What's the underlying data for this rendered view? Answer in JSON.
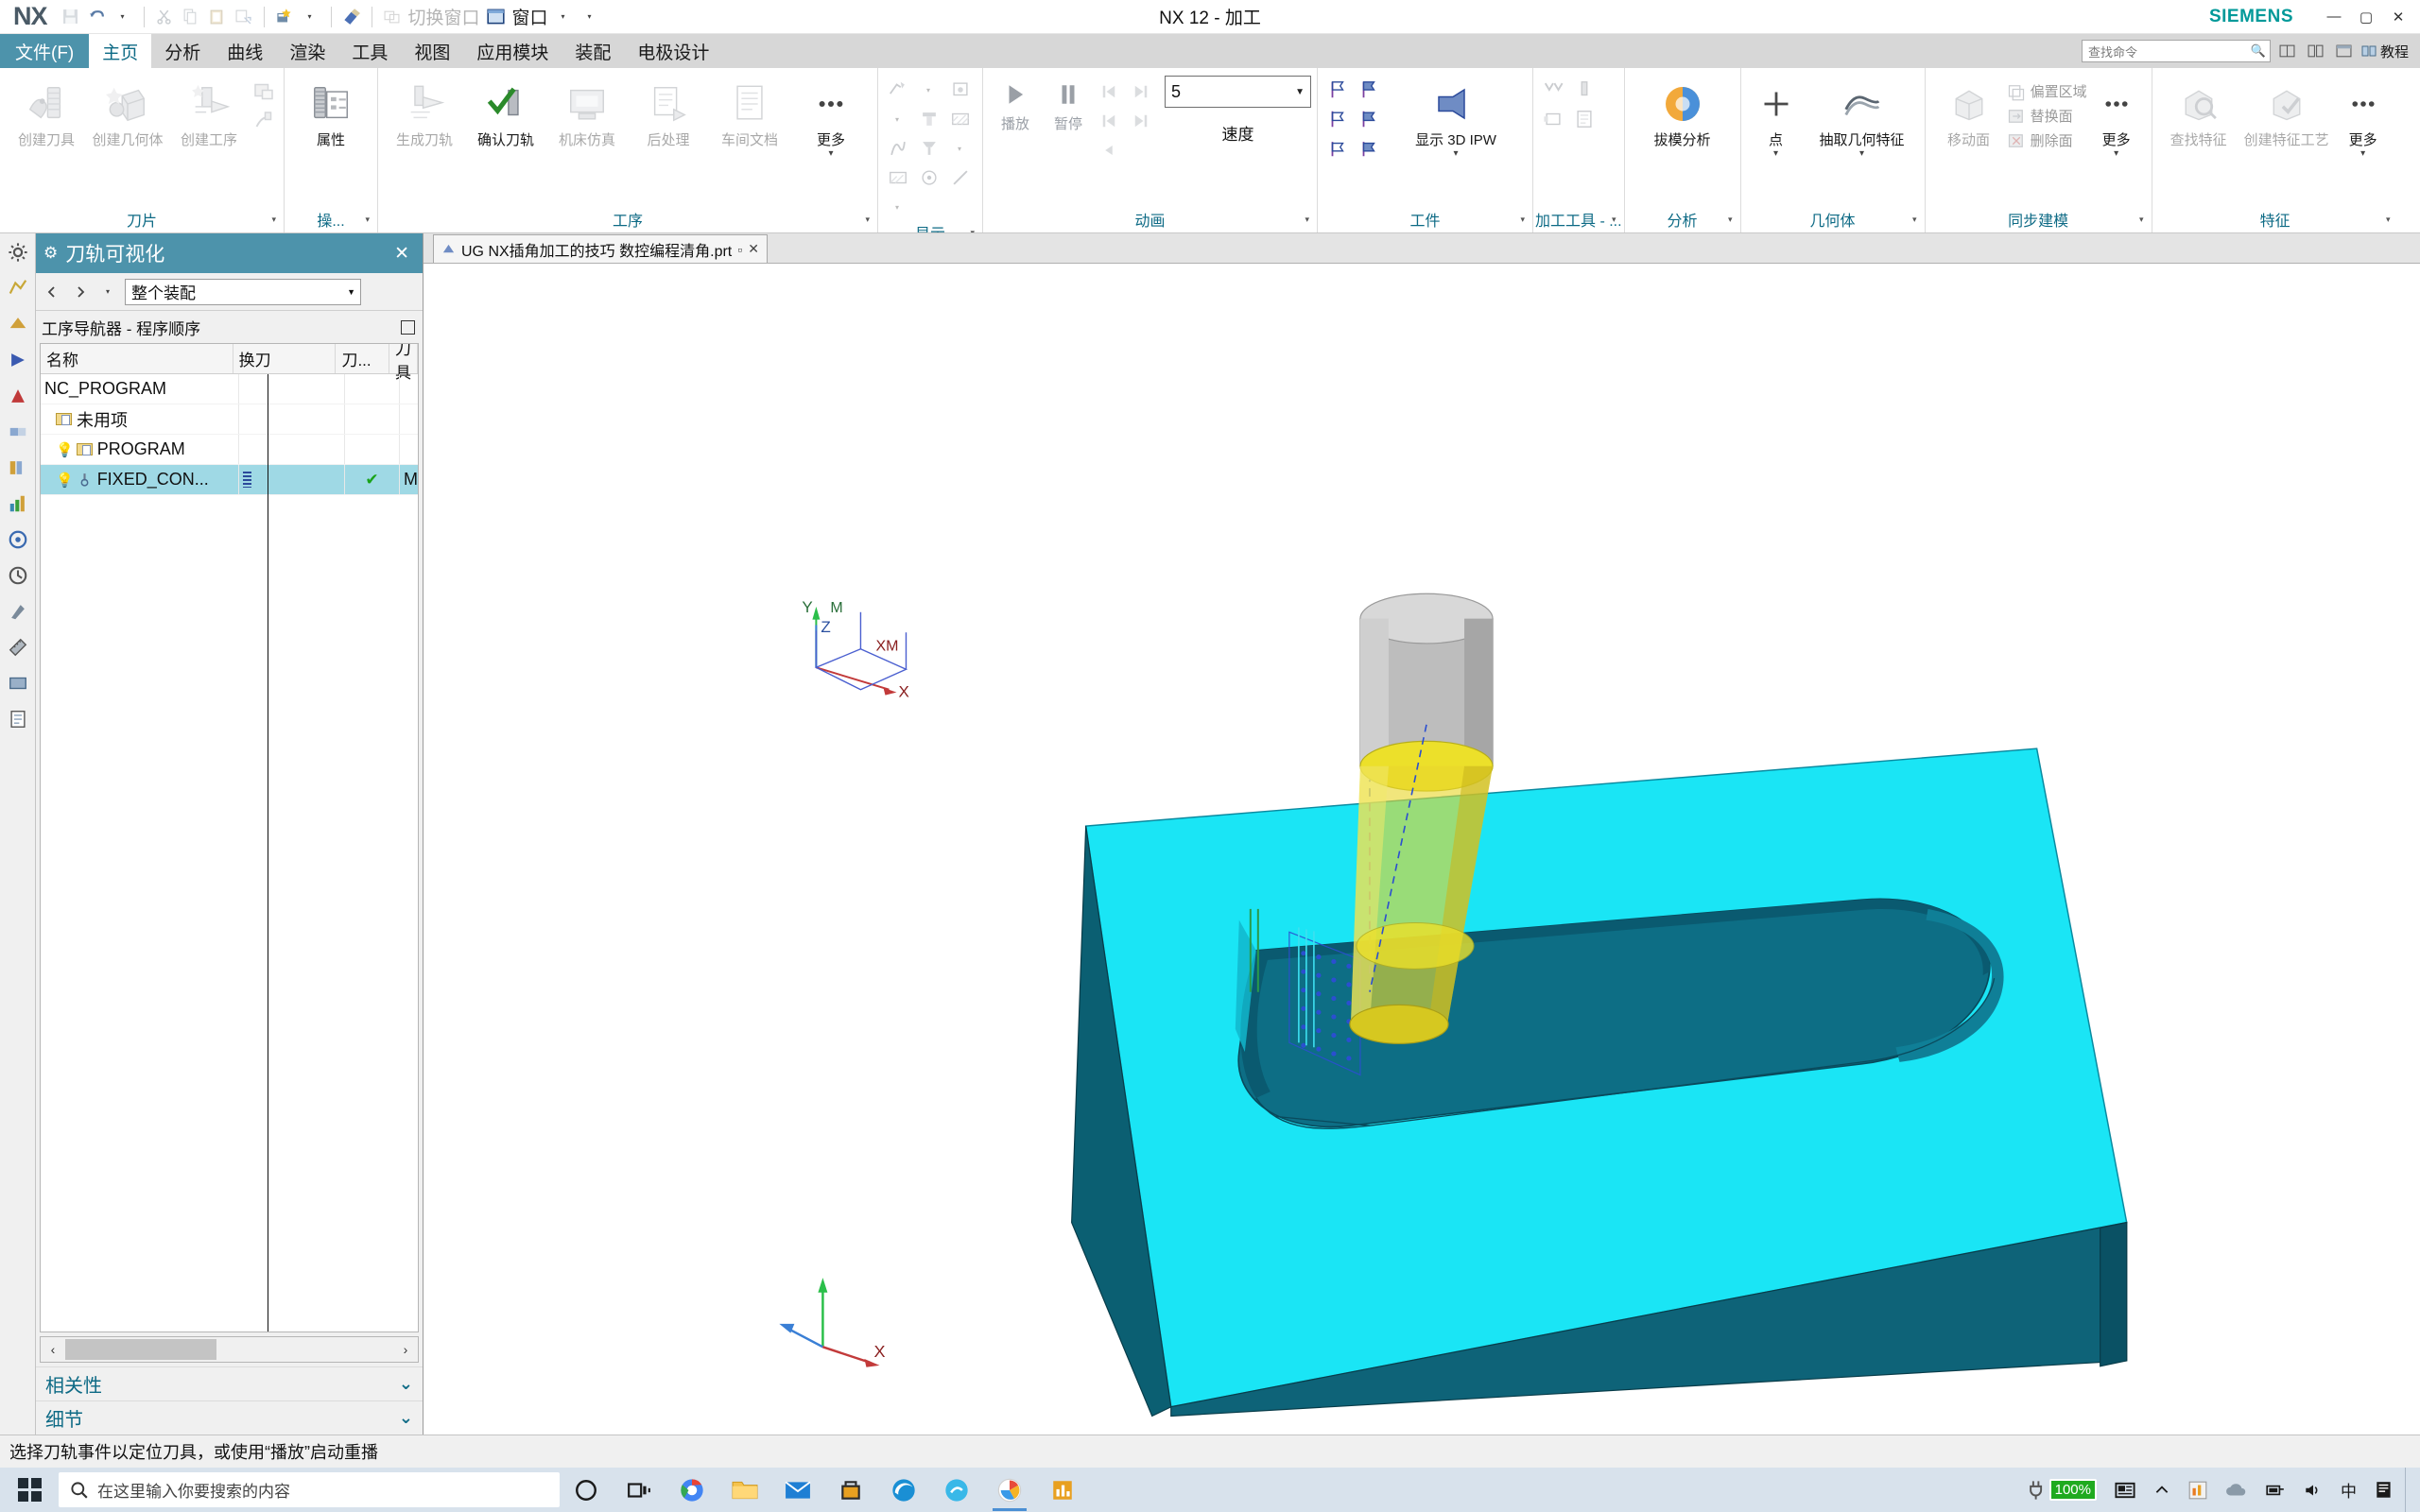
{
  "titlebar": {
    "logo": "NX",
    "title": "NX 12 - 加工",
    "brand": "SIEMENS",
    "quick_access": [
      {
        "name": "save-icon",
        "label": "保存",
        "dim": true
      },
      {
        "name": "undo-icon",
        "label": "撤销",
        "dim": false
      },
      {
        "name": "cut-icon",
        "label": "剪切",
        "dim": true
      },
      {
        "name": "copy-icon",
        "label": "复制",
        "dim": true
      },
      {
        "name": "paste-icon",
        "label": "粘贴",
        "dim": true
      },
      {
        "name": "paste-special-icon",
        "label": "选择性粘贴",
        "dim": true
      },
      {
        "name": "command-finder-icon",
        "label": "命令查找器",
        "dim": false
      },
      {
        "name": "eraser-icon",
        "label": "橡皮",
        "dim": false
      }
    ],
    "switch_window": "切换窗口",
    "window": "窗口",
    "win_buttons": {
      "minimize": "—",
      "maximize": "▢",
      "close": "✕"
    }
  },
  "menu": {
    "file_tab": "文件(F)",
    "tabs": [
      {
        "label": "主页",
        "active": true
      },
      {
        "label": "分析",
        "active": false
      },
      {
        "label": "曲线",
        "active": false
      },
      {
        "label": "渲染",
        "active": false
      },
      {
        "label": "工具",
        "active": false
      },
      {
        "label": "视图",
        "active": false
      },
      {
        "label": "应用模块",
        "active": false
      },
      {
        "label": "装配",
        "active": false
      },
      {
        "label": "电极设计",
        "active": false
      }
    ],
    "search_placeholder": "查找命令",
    "tutorial": "教程"
  },
  "ribbon": {
    "groups": [
      {
        "label": "刀片",
        "big_buttons": [
          {
            "label": "创建刀具",
            "icon": "create-tool-icon",
            "dim": true
          },
          {
            "label": "创建几何体",
            "icon": "create-geometry-icon",
            "dim": true
          },
          {
            "label": "创建工序",
            "icon": "create-operation-icon",
            "dim": true
          }
        ],
        "small_buttons": [
          {
            "name": "create-program-icon",
            "dim": true
          },
          {
            "name": "create-method-icon",
            "dim": true
          }
        ]
      },
      {
        "label": "操...",
        "big_buttons": [
          {
            "label": "属性",
            "icon": "properties-icon",
            "dim": false
          }
        ],
        "small_buttons": []
      },
      {
        "label": "工序",
        "big_buttons": [
          {
            "label": "生成刀轨",
            "icon": "generate-toolpath-icon",
            "dim": true
          },
          {
            "label": "确认刀轨",
            "icon": "verify-toolpath-icon",
            "dim": false
          },
          {
            "label": "机床仿真",
            "icon": "machine-sim-icon",
            "dim": true
          },
          {
            "label": "后处理",
            "icon": "postprocess-icon",
            "dim": true
          },
          {
            "label": "车间文档",
            "icon": "shop-doc-icon",
            "dim": true
          },
          {
            "label": "更多",
            "icon": "more-icon",
            "dim": false
          }
        ],
        "small_buttons": []
      },
      {
        "label": "显示",
        "big_buttons": [],
        "small_buttons": [
          {
            "name": "display-toolpath-icon",
            "dim": true
          },
          {
            "name": "display-tool-icon",
            "dim": true
          },
          {
            "name": "display-holder-icon",
            "dim": true
          },
          {
            "name": "hatch-area-icon",
            "dim": true
          },
          {
            "name": "curve-icon",
            "dim": true
          },
          {
            "name": "tool-shape-icon",
            "dim": true
          },
          {
            "name": "hatch-area2-icon",
            "dim": true
          },
          {
            "name": "point-target-icon",
            "dim": true
          },
          {
            "name": "line-icon",
            "dim": true
          }
        ]
      },
      {
        "label": "动画",
        "play": "播放",
        "pause": "暂停",
        "step_back": "上一步",
        "step_fwd": "下一步",
        "speed_value": "5",
        "speed_label": "速度",
        "big_buttons": [],
        "small_buttons": []
      },
      {
        "label": "工件",
        "big_buttons": [
          {
            "label": "显示 3D IPW",
            "icon": "show-3d-ipw-icon",
            "dim": false
          }
        ],
        "small_buttons": [
          {
            "name": "ipw-flag1-icon",
            "dim": false
          },
          {
            "name": "ipw-flag2-icon",
            "dim": false
          },
          {
            "name": "ipw-flag3-icon",
            "dim": false
          },
          {
            "name": "ipw-flag4-icon",
            "dim": false
          },
          {
            "name": "ipw-flag5-icon",
            "dim": false
          },
          {
            "name": "ipw-flag6-icon",
            "dim": false
          }
        ]
      },
      {
        "label": "加工工具 - ...",
        "big_buttons": [],
        "small_buttons": [
          {
            "name": "mt-check-icon",
            "dim": true
          },
          {
            "name": "mt-tool-icon",
            "dim": true
          },
          {
            "name": "mt-frame-icon",
            "dim": true
          },
          {
            "name": "mt-page-icon",
            "dim": true
          }
        ]
      },
      {
        "label": "分析",
        "big_buttons": [
          {
            "label": "拔模分析",
            "icon": "draft-analysis-icon",
            "dim": false
          }
        ],
        "small_buttons": []
      },
      {
        "label": "几何体",
        "big_buttons": [
          {
            "label": "点",
            "icon": "point-icon",
            "dim": false
          },
          {
            "label": "抽取几何特征",
            "icon": "extract-geometry-icon",
            "dim": false
          }
        ],
        "small_buttons": []
      },
      {
        "label": "同步建模",
        "big_buttons": [
          {
            "label": "移动面",
            "icon": "move-face-icon",
            "dim": true
          },
          {
            "label": "更多",
            "icon": "more-sync-icon",
            "dim": false
          }
        ],
        "stack_labels": [
          "偏置区域",
          "替换面",
          "删除面"
        ]
      },
      {
        "label": "特征",
        "big_buttons": [
          {
            "label": "查找特征",
            "icon": "find-feature-icon",
            "dim": true
          },
          {
            "label": "创建特征工艺",
            "icon": "create-feature-process-icon",
            "dim": true
          },
          {
            "label": "更多",
            "icon": "more-feature-icon",
            "dim": false
          }
        ],
        "small_buttons": []
      }
    ]
  },
  "left_panel": {
    "title": "刀轨可视化",
    "title_icon": "gear-icon",
    "close": "✕",
    "assembly_select": "整个装配",
    "navigator_title": "工序导航器 - 程序顺序",
    "columns": [
      "名称",
      "换刀",
      "刀...",
      "刀具"
    ],
    "rows": [
      {
        "name": "NC_PROGRAM",
        "indent": 0,
        "icon": "none",
        "bulb": false,
        "swap": "",
        "cut": "",
        "tool": "",
        "selected": false
      },
      {
        "name": "未用项",
        "indent": 1,
        "icon": "folder",
        "bulb": false,
        "swap": "",
        "cut": "",
        "tool": "",
        "selected": false
      },
      {
        "name": "PROGRAM",
        "indent": 1,
        "icon": "folder",
        "bulb": true,
        "swap": "",
        "cut": "",
        "tool": "",
        "selected": false
      },
      {
        "name": "FIXED_CON...",
        "indent": 1,
        "icon": "operation",
        "bulb": true,
        "swap": "barcode",
        "cut": "check",
        "tool": "MIL",
        "selected": true
      }
    ],
    "sections": [
      {
        "label": "相关性",
        "chevron": "⌄"
      },
      {
        "label": "细节",
        "chevron": "⌄"
      }
    ]
  },
  "graphics": {
    "tab_label": "UG NX插角加工的技巧 数控编程清角.prt",
    "tab_modified": "▫",
    "tab_close": "✕",
    "wcs_labels": {
      "x": "X",
      "y": "Y",
      "z": "Z",
      "xm": "XM",
      "ym": "YM",
      "zm": "M"
    },
    "triad_label_x": "X",
    "colors": {
      "stock_top": "#1ae5f5",
      "stock_side_dark": "#0d6b80",
      "stock_front": "#0e5f72",
      "pocket_floor": "#0f7d92",
      "tool_shank": "#b6b6b6",
      "tool_cut": "#e8d62c",
      "toolpath": "#3a59d0"
    }
  },
  "statusbar": {
    "message": "选择刀轨事件以定位刀具，或使用“播放”启动重播"
  },
  "taskbar": {
    "search_placeholder": "在这里输入你要搜索的内容",
    "search_icon": "search-icon",
    "items": [
      {
        "name": "cortana-icon",
        "label": "Cortana"
      },
      {
        "name": "task-view-icon",
        "label": "任务视图"
      },
      {
        "name": "chrome-icon",
        "label": "Chrome"
      },
      {
        "name": "file-explorer-icon",
        "label": "文件资源管理器"
      },
      {
        "name": "mail-icon",
        "label": "邮件"
      },
      {
        "name": "store-icon",
        "label": "Microsoft Store"
      },
      {
        "name": "edge-icon",
        "label": "Edge"
      },
      {
        "name": "app-blue-icon",
        "label": "应用"
      },
      {
        "name": "nx-icon",
        "label": "NX",
        "active": true
      },
      {
        "name": "chart-app-icon",
        "label": "图表应用"
      }
    ],
    "battery_percent": "100%",
    "tray": [
      {
        "name": "news-icon",
        "label": "新闻"
      },
      {
        "name": "chevron-up-icon",
        "label": "显示隐藏的图标"
      },
      {
        "name": "orange-app-icon",
        "label": "托盘应用"
      },
      {
        "name": "onedrive-icon",
        "label": "OneDrive"
      },
      {
        "name": "network-icon",
        "label": "网络"
      },
      {
        "name": "volume-icon",
        "label": "音量"
      },
      {
        "name": "ime-icon",
        "label": "中"
      },
      {
        "name": "notification-icon",
        "label": "通知"
      }
    ]
  }
}
